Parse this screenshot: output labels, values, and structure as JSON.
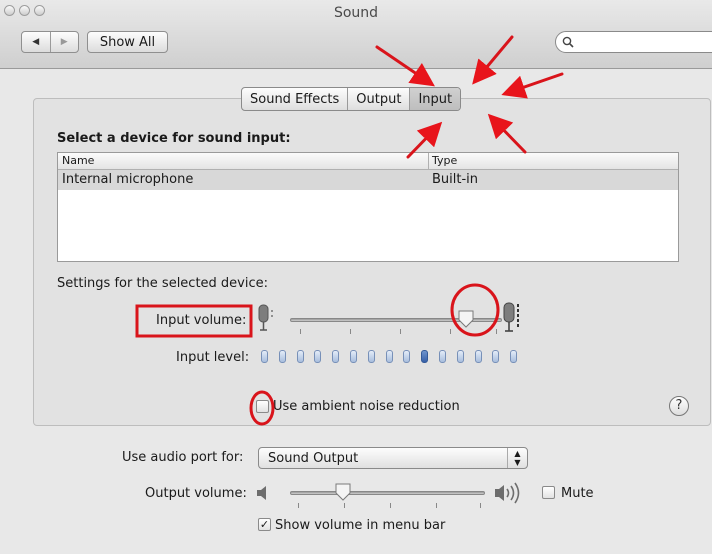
{
  "window": {
    "title": "Sound",
    "nav_back_icon": "◀",
    "nav_forward_icon": "▶",
    "show_all_label": "Show All",
    "search_icon": "magnifier-icon"
  },
  "tabs": [
    {
      "label": "Sound Effects",
      "selected": false
    },
    {
      "label": "Output",
      "selected": false
    },
    {
      "label": "Input",
      "selected": true
    }
  ],
  "device_section": {
    "heading": "Select a device for sound input:",
    "columns": [
      "Name",
      "Type"
    ],
    "rows": [
      {
        "name": "Internal microphone",
        "type": "Built-in"
      }
    ]
  },
  "settings": {
    "heading": "Settings for the selected device:",
    "input_volume_label": "Input volume:",
    "input_volume_value": 0.83,
    "input_level_label": "Input level:",
    "input_level_total": 15,
    "input_level_lit": 10,
    "ambient_noise_label": "Use ambient noise reduction",
    "ambient_noise_checked": false,
    "help_label": "?"
  },
  "output": {
    "audio_port_label": "Use audio port for:",
    "audio_port_value": "Sound Output",
    "output_volume_label": "Output volume:",
    "output_volume_value": 0.27,
    "mute_label": "Mute",
    "mute_checked": false,
    "show_volume_label": "Show volume in menu bar",
    "show_volume_checked": true,
    "checkmark": "✓"
  },
  "annotations": {
    "arrow_color": "#e8141b",
    "marker_color": "#d9141b"
  }
}
